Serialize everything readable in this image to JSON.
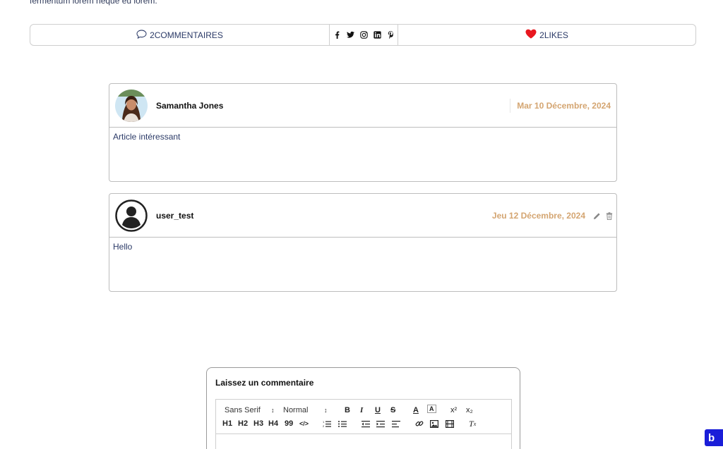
{
  "intro": {
    "text": "fermentum lorem neque eu lorem."
  },
  "share_bar": {
    "comments_label": "2COMMENTAIRES",
    "social_icons": [
      "facebook-icon",
      "twitter-icon",
      "instagram-icon",
      "linkedin-icon",
      "pinterest-icon"
    ],
    "likes_label": "2LIKES",
    "like_color": "#e8171f"
  },
  "comments": [
    {
      "author": "Samantha Jones",
      "date": "Mar 10 Décembre, 2024",
      "body": "Article intéressant",
      "avatar": "photo"
    },
    {
      "author": "user_test",
      "date": "Jeu 12 Décembre, 2024",
      "body": "Hello",
      "avatar": "default-user-icon"
    }
  ],
  "comment_form": {
    "title": "Laissez un commentaire",
    "toolbar": {
      "font_select": "Sans Serif",
      "size_select": "Normal",
      "row1_buttons": [
        "B",
        "I",
        "U",
        "S",
        "A",
        "A",
        "x²",
        "x₂"
      ],
      "row2_buttons": [
        "H1",
        "H2",
        "H3",
        "H4",
        "99",
        "</>"
      ]
    }
  },
  "brand_badge": {
    "label": "b"
  },
  "colors": {
    "accent_date": "#d4a571",
    "text": "#2b3a67",
    "badge": "#1a1ed8"
  }
}
